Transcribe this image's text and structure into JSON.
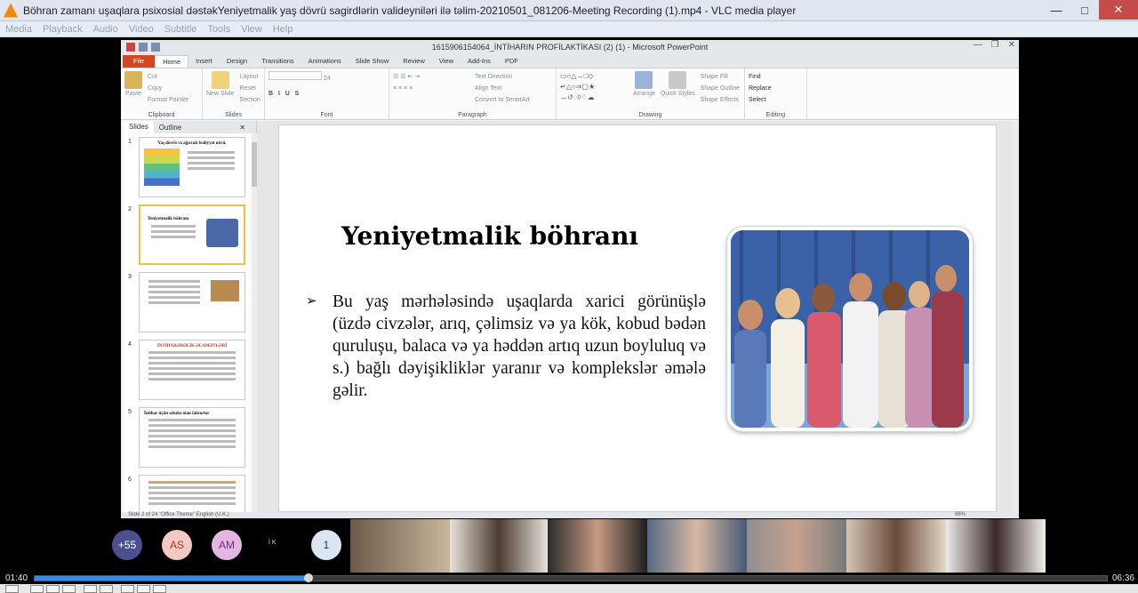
{
  "vlc": {
    "title": "Böhran zamanı uşaqlara psixosial dəstəkYeniyetmalik yaş dövrü sagirdlərin valideyniləri ilə təlim-20210501_081206-Meeting Recording (1).mp4 - VLC media player",
    "menu": [
      "Media",
      "Playback",
      "Audio",
      "Video",
      "Subtitle",
      "Tools",
      "View",
      "Help"
    ],
    "time_current": "01:40",
    "time_total": "06:36",
    "progress_fraction": 0.255
  },
  "ppt": {
    "window_title": "1615906154064_İNTİHARIN PROFİLAKTİKASI (2) (1) - Microsoft PowerPoint",
    "tabs": [
      "File",
      "Home",
      "Insert",
      "Design",
      "Transitions",
      "Animations",
      "Slide Show",
      "Review",
      "View",
      "Add-Ins",
      "PDF"
    ],
    "ribbon": {
      "clipboard": {
        "paste": "Paste",
        "cut": "Cut",
        "copy": "Copy",
        "format_painter": "Format Painter",
        "label": "Clipboard"
      },
      "slides": {
        "new_slide": "New Slide",
        "layout": "Layout",
        "reset": "Reset",
        "section": "Section",
        "label": "Slides"
      },
      "font": {
        "size": "24",
        "bold": "B",
        "italic": "I",
        "underline": "U",
        "strike": "S",
        "label": "Font"
      },
      "paragraph": {
        "text_direction": "Text Direction",
        "align_text": "Align Text",
        "convert": "Convert to SmartArt",
        "label": "Paragraph"
      },
      "drawing": {
        "arrange": "Arrange",
        "quick_styles": "Quick Styles",
        "shape_fill": "Shape Fill",
        "shape_outline": "Shape Outline",
        "shape_effects": "Shape Effects",
        "label": "Drawing"
      },
      "editing": {
        "find": "Find",
        "replace": "Replace",
        "select": "Select",
        "label": "Editing"
      }
    },
    "panel_tabs": {
      "slides": "Slides",
      "outline": "Outline"
    },
    "thumbnails": [
      {
        "num": "1",
        "title": "Yaş dövrü və ağırcalı fealiyyət növü."
      },
      {
        "num": "2",
        "title": "Yeniyetmalik böhranı"
      },
      {
        "num": "3",
        "title": ""
      },
      {
        "num": "4",
        "title": "İNTİHARƏDƏLİK ƏLAMƏTLƏRİ"
      },
      {
        "num": "5",
        "title": "İntihar üçün səbəbə olan faktorlar"
      },
      {
        "num": "6",
        "title": ""
      }
    ],
    "slide": {
      "title": "Yeniyetmalik böhranı",
      "bullet_mark": "➢",
      "bullet": "Bu yaş mərhələsində uşaqlarda xarici görünüşlə (üzdə civzələr, arıq, çəlimsiz və ya kök, kobud bədən quruluşu, balaca və ya həddən artıq uzun boyluluq və s.) bağlı dəyişikliklər yaranır və komplekslər əmələ gəlir."
    },
    "status_text": "Slide 2 of 24   \"Office Theme\"   English (U.K.)",
    "zoom": "96%"
  },
  "participants": {
    "badges": [
      "+55",
      "AS",
      "AM",
      "1"
    ],
    "ik": "İ K",
    "badge_colors": {
      "more": "#4b4f8f",
      "as": "#f3c9c4",
      "am": "#e3b6e3",
      "one": "#dce6f2"
    }
  }
}
